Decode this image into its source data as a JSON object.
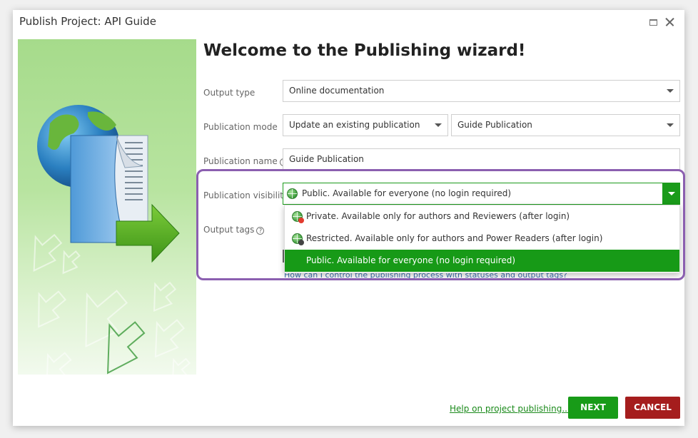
{
  "window": {
    "title": "Publish Project: API Guide"
  },
  "wizard": {
    "heading": "Welcome to the Publishing wizard!"
  },
  "form": {
    "output_type": {
      "label": "Output type",
      "value": "Online documentation"
    },
    "publication_mode": {
      "label": "Publication mode",
      "value": "Update an existing publication",
      "target": "Guide Publication"
    },
    "publication_name": {
      "label": "Publication name",
      "value": "Guide Publication"
    },
    "publication_visibility": {
      "label": "Publication visibility",
      "value": "Public. Available for everyone (no login required)",
      "options": [
        "Private. Available only for authors and Reviewers (after login)",
        "Restricted. Available only for authors and Power Readers (after login)",
        "Public. Available for everyone (no login required)"
      ]
    },
    "output_tags": {
      "label": "Output tags"
    },
    "tags_help_link": "How can I control the publishing process with statuses and output tags?"
  },
  "footer": {
    "help_link": "Help on project publishing...",
    "next_label": "NEXT",
    "cancel_label": "CANCEL"
  },
  "icons": {
    "help": "?"
  },
  "colors": {
    "accent_green": "#189b18",
    "cancel_red": "#a51d1d",
    "highlight_purple": "#8b5fb0"
  }
}
